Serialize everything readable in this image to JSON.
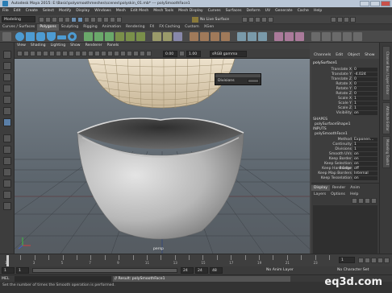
{
  "titlebar": {
    "title": "Autodesk Maya 2015: E:\\Basic\\polysmoothmeshes\\scenes\\polyskin_01.mb* --- polySmoothFace1"
  },
  "menubar": {
    "items": [
      "File",
      "Edit",
      "Create",
      "Select",
      "Modify",
      "Display",
      "Windows",
      "Mesh",
      "Edit Mesh",
      "Mesh Tools",
      "Mesh Display",
      "Curves",
      "Surfaces",
      "Deform",
      "UV",
      "Generate",
      "Cache",
      "Help"
    ]
  },
  "statusline": {
    "mode": "Modeling",
    "live": "No Live Surface"
  },
  "shelf": {
    "tabs": [
      "Curves / Surfaces",
      "Polygons",
      "Sculpting",
      "Rigging",
      "Animation",
      "Rendering",
      "FX",
      "FX Caching",
      "Custom",
      "XGen"
    ],
    "active": "Polygons"
  },
  "viewport": {
    "menu": [
      "View",
      "Shading",
      "Lighting",
      "Show",
      "Renderer",
      "Panels"
    ],
    "field_a": "0.00",
    "field_b": "1.00",
    "color_space": "sRGB gamma",
    "camera_label": "persp"
  },
  "popup": {
    "label": "Divisions",
    "value": "1"
  },
  "channelbox": {
    "tabs": [
      "Channel Box / Layer Editor"
    ],
    "menu": [
      "Channels",
      "Edit",
      "Object",
      "Show"
    ],
    "object": "polySurface1",
    "attrs": [
      {
        "name": "Translate X",
        "value": "0"
      },
      {
        "name": "Translate Y",
        "value": "-4.024"
      },
      {
        "name": "Translate Z",
        "value": "0"
      },
      {
        "name": "Rotate X",
        "value": "0"
      },
      {
        "name": "Rotate Y",
        "value": "0"
      },
      {
        "name": "Rotate Z",
        "value": "0"
      },
      {
        "name": "Scale X",
        "value": "1"
      },
      {
        "name": "Scale Y",
        "value": "1"
      },
      {
        "name": "Scale Z",
        "value": "1"
      },
      {
        "name": "Visibility",
        "value": "on"
      }
    ],
    "shapes_label": "SHAPES",
    "shape_name": "polySurfaceShape1",
    "inputs_label": "INPUTS",
    "input_name": "polySmoothFace1",
    "input_attrs": [
      {
        "name": "Method",
        "value": "Exponen..."
      },
      {
        "name": "Continuity",
        "value": "1"
      },
      {
        "name": "Divisions",
        "value": "1"
      },
      {
        "name": "Smooth UVs",
        "value": "on"
      },
      {
        "name": "Keep Border",
        "value": "on"
      },
      {
        "name": "Keep Selection Border",
        "value": "on"
      },
      {
        "name": "Keep Hard Edge",
        "value": "off"
      },
      {
        "name": "Keep Map Borders",
        "value": "Internal"
      },
      {
        "name": "Keep Tesselation",
        "value": "on"
      }
    ]
  },
  "layers": {
    "tabs": [
      "Display",
      "Render",
      "Anim"
    ],
    "active": "Display",
    "menu": [
      "Layers",
      "Options",
      "Help"
    ]
  },
  "sidetabs": [
    "Channel Box / Layer Editor",
    "Attribute Editor",
    "Modeling Toolkit"
  ],
  "timeslider": {
    "ticks": [
      "1",
      "2",
      "3",
      "4",
      "5",
      "6",
      "7",
      "8",
      "9",
      "10",
      "11",
      "12",
      "13",
      "14",
      "15",
      "16",
      "17",
      "18",
      "19",
      "20",
      "21",
      "22",
      "23",
      "24"
    ],
    "current": "1"
  },
  "range": {
    "start": "1",
    "start2": "1",
    "end": "24",
    "end2": "24",
    "end3": "48",
    "anim_layer": "No Anim Layer",
    "char_set": "No Character Set"
  },
  "cmdline": {
    "lang": "MEL",
    "result": "// Result: polySmoothFace1"
  },
  "helpline": {
    "text": "Set the number of times the Smooth operation is performed."
  },
  "watermark": "eq3d.com"
}
